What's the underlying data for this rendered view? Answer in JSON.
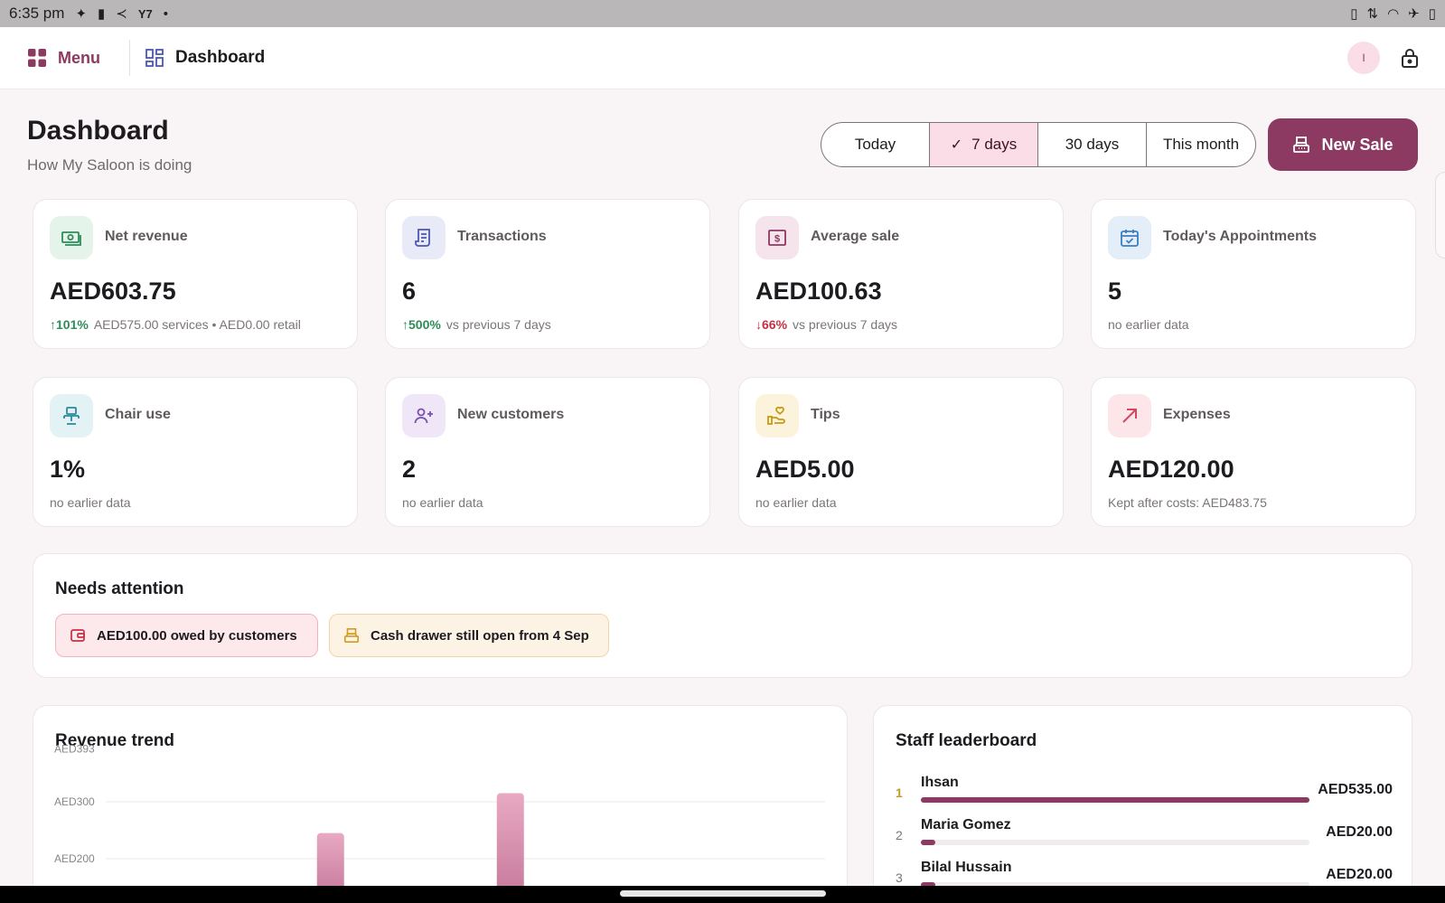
{
  "status_bar": {
    "time": "6:35 pm",
    "carrier_icon": "Y7"
  },
  "appbar": {
    "menu_label": "Menu",
    "breadcrumb": "Dashboard",
    "avatar_initial": "I"
  },
  "header": {
    "title": "Dashboard",
    "subtitle": "How My Saloon is doing"
  },
  "range_tabs": [
    {
      "label": "Today",
      "active": false
    },
    {
      "label": "7 days",
      "active": true
    },
    {
      "label": "30 days",
      "active": false
    },
    {
      "label": "This month",
      "active": false
    }
  ],
  "new_sale_label": "New Sale",
  "stats": [
    {
      "label": "Net revenue",
      "value": "AED603.75",
      "change": "101%",
      "direction": "up",
      "note": "AED575.00 services • AED0.00 retail",
      "icon": "cash-icon",
      "accent": "#2e8b57",
      "bg": "#e4f4ea"
    },
    {
      "label": "Transactions",
      "value": "6",
      "change": "500%",
      "direction": "up",
      "note": "vs previous 7 days",
      "icon": "receipt-icon",
      "accent": "#4b57b5",
      "bg": "#e8eaf8"
    },
    {
      "label": "Average sale",
      "value": "AED100.63",
      "change": "66%",
      "direction": "down",
      "note": "vs previous 7 days",
      "icon": "dollar-icon",
      "accent": "#8c3a62",
      "bg": "#f6e4ec"
    },
    {
      "label": "Today's Appointments",
      "value": "5",
      "change": "",
      "direction": "",
      "note": "no earlier data",
      "icon": "calendar-icon",
      "accent": "#3b7dc4",
      "bg": "#e4eef9"
    },
    {
      "label": "Chair use",
      "value": "1%",
      "change": "",
      "direction": "",
      "note": "no earlier data",
      "icon": "chair-icon",
      "accent": "#2a8aa3",
      "bg": "#e2f2f5"
    },
    {
      "label": "New customers",
      "value": "2",
      "change": "",
      "direction": "",
      "note": "no earlier data",
      "icon": "person-add-icon",
      "accent": "#7a4fb0",
      "bg": "#efe7f7"
    },
    {
      "label": "Tips",
      "value": "AED5.00",
      "change": "",
      "direction": "",
      "note": "no earlier data",
      "icon": "hand-heart-icon",
      "accent": "#c79a12",
      "bg": "#fbf3dc"
    },
    {
      "label": "Expenses",
      "value": "AED120.00",
      "change": "",
      "direction": "",
      "note": "Kept after costs: AED483.75",
      "icon": "arrow-up-right-icon",
      "accent": "#d2485e",
      "bg": "#fde6ea"
    }
  ],
  "attention": {
    "title": "Needs attention",
    "items": [
      {
        "label": "AED100.00 owed by customers",
        "icon": "wallet-icon",
        "color": "#c62f45"
      },
      {
        "label": "Cash drawer still open from 4 Sep",
        "icon": "cash-register-icon",
        "color": "#d49a1e"
      }
    ]
  },
  "revenue_trend": {
    "title": "Revenue trend"
  },
  "chart_data": {
    "type": "bar",
    "title": "Revenue trend",
    "y_ticks": [
      "AED393",
      "AED300",
      "AED200"
    ],
    "ylim": [
      0,
      393
    ],
    "values": [
      0,
      0,
      0,
      245,
      0,
      0,
      315,
      0,
      0,
      0,
      0,
      0
    ],
    "visible_min": 195
  },
  "leaderboard": {
    "title": "Staff leaderboard",
    "rows": [
      {
        "rank": "1",
        "name": "Ihsan",
        "amount": "AED535.00",
        "share": 1.0
      },
      {
        "rank": "2",
        "name": "Maria Gomez",
        "amount": "AED20.00",
        "share": 0.037
      },
      {
        "rank": "3",
        "name": "Bilal Hussain",
        "amount": "AED20.00",
        "share": 0.037
      }
    ]
  }
}
